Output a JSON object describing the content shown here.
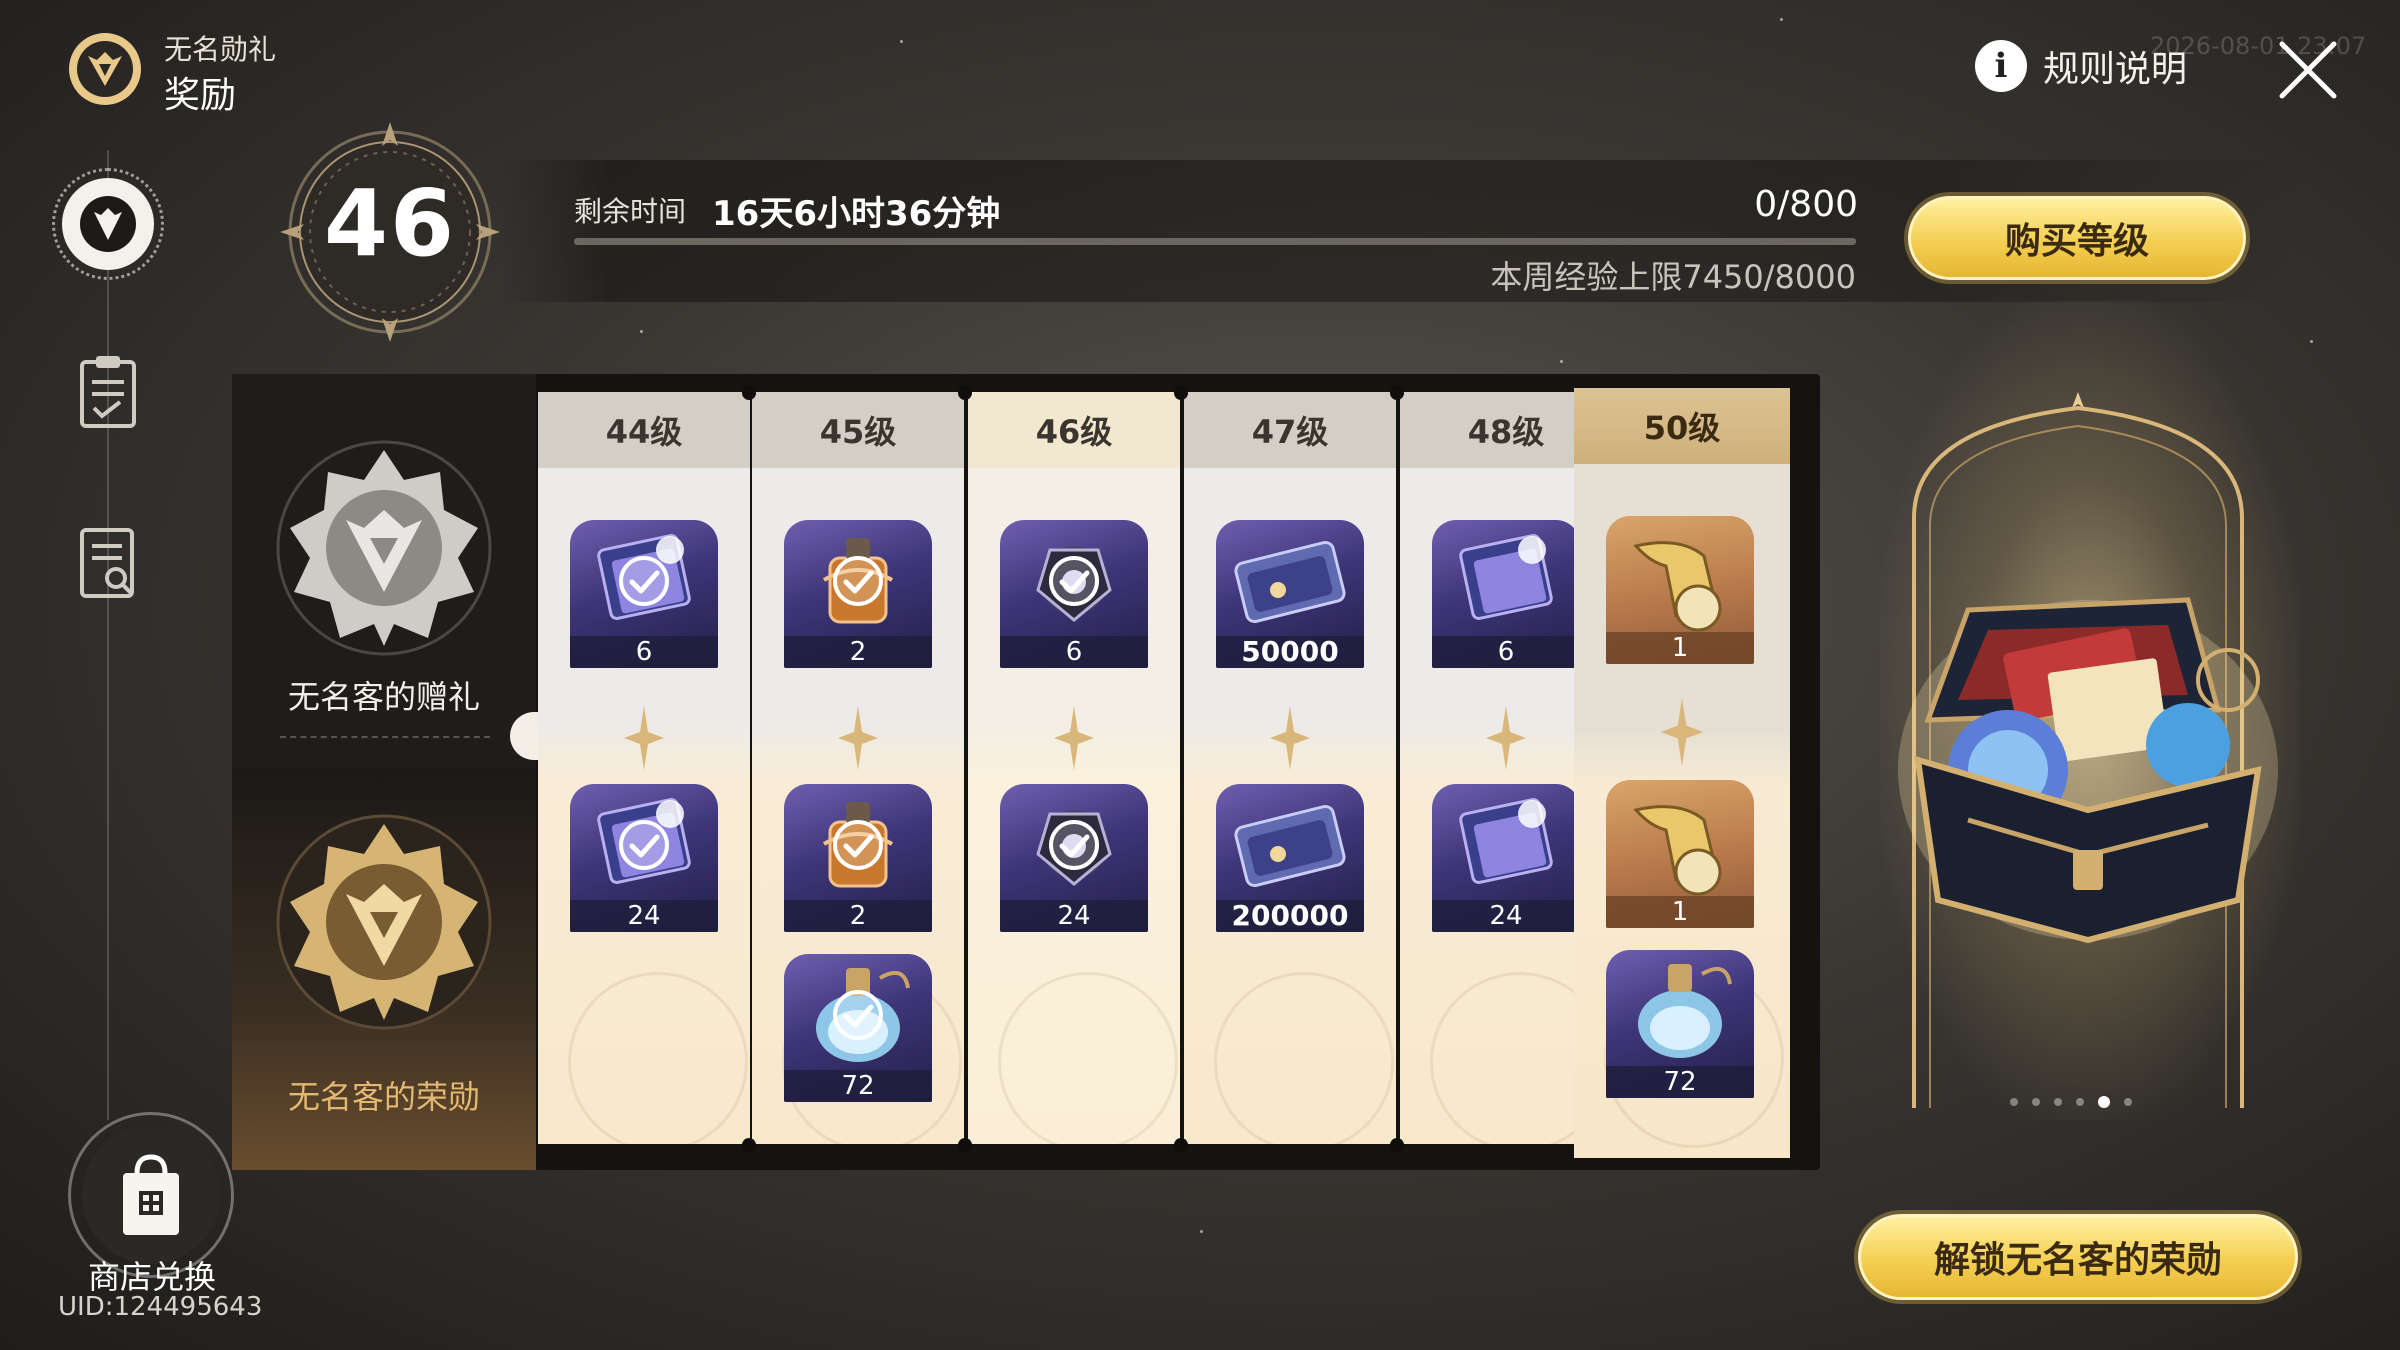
{
  "header": {
    "subtitle": "无名勋礼",
    "title": "奖励",
    "rules_label": "规则说明",
    "timestamp": "2026-08-01 23:07"
  },
  "nav": {
    "shop_label": "商店兑换",
    "uid": "UID:124495643"
  },
  "level": {
    "current": "46"
  },
  "progress": {
    "time_label": "剩余时间",
    "time_value": "16天6小时36分钟",
    "exp": "0/800",
    "exp_fraction": 0,
    "weekly_cap": "本周经验上限7450/8000"
  },
  "buttons": {
    "buy_level": "购买等级",
    "unlock": "解锁无名客的荣勋"
  },
  "tracks": {
    "free": "无名客的赠礼",
    "paid": "无名客的荣勋"
  },
  "levels": [
    {
      "label": "44级",
      "free": {
        "count": "6",
        "icon": "book-icon",
        "claimed": true
      },
      "paid": [
        {
          "count": "24",
          "icon": "book-icon",
          "claimed": true
        }
      ]
    },
    {
      "label": "45级",
      "free": {
        "count": "2",
        "icon": "potion-icon",
        "claimed": true
      },
      "paid": [
        {
          "count": "2",
          "icon": "potion-icon",
          "claimed": true
        },
        {
          "count": "72",
          "icon": "flask-icon",
          "claimed": true
        }
      ]
    },
    {
      "label": "46级",
      "free": {
        "count": "6",
        "icon": "relic-icon",
        "claimed": true
      },
      "paid": [
        {
          "count": "24",
          "icon": "relic-icon",
          "claimed": true
        }
      ]
    },
    {
      "label": "47级",
      "free": {
        "count": "50000",
        "icon": "credit-icon",
        "claimed": false
      },
      "paid": [
        {
          "count": "200000",
          "icon": "credit-icon",
          "claimed": false
        }
      ]
    },
    {
      "label": "48级",
      "free": {
        "count": "6",
        "icon": "book-icon",
        "claimed": false
      },
      "paid": [
        {
          "count": "24",
          "icon": "book-icon",
          "claimed": false
        }
      ]
    },
    {
      "label": "50级",
      "free": {
        "count": "1",
        "icon": "trumpet-icon",
        "claimed": false
      },
      "paid": [
        {
          "count": "1",
          "icon": "trumpet-icon",
          "claimed": false
        },
        {
          "count": "72",
          "icon": "flask-icon",
          "claimed": false
        }
      ]
    }
  ],
  "pagination": {
    "total": 6,
    "active": 4
  },
  "colors": {
    "gold": "#f4cf52",
    "accent": "#e2b872",
    "panel": "#141311"
  }
}
